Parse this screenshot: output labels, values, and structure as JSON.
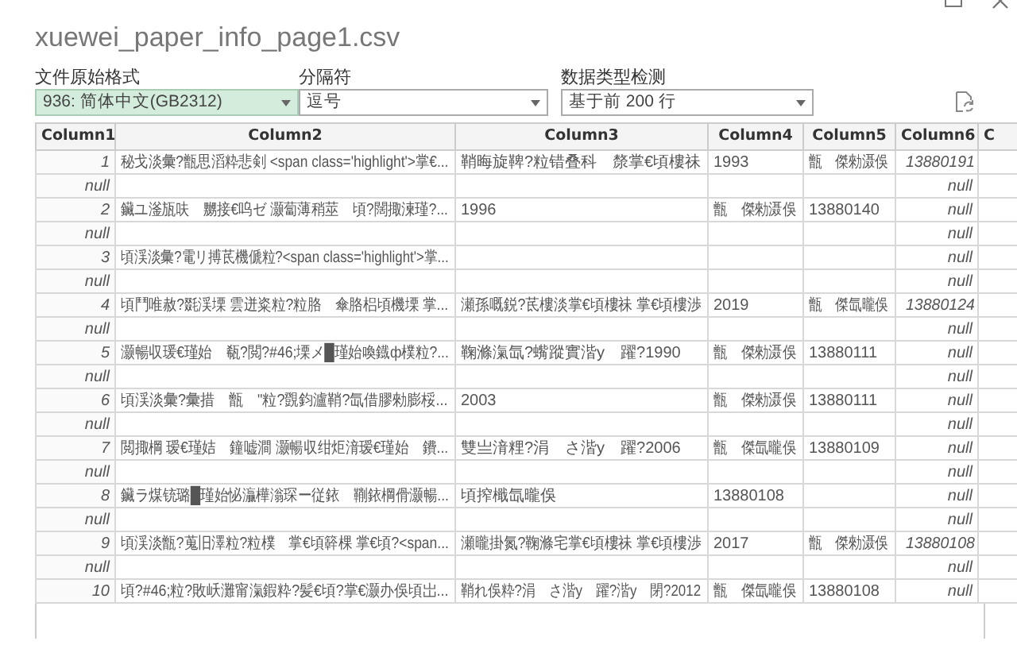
{
  "window": {
    "title": "xuewei_paper_info_page1.csv"
  },
  "options": [
    {
      "label": "文件原始格式",
      "value": "936: 简体中文(GB2312)",
      "focused": true
    },
    {
      "label": "分隔符",
      "value": "逗号",
      "focused": false
    },
    {
      "label": "数据类型检测",
      "value": "基于前 200 行",
      "focused": false
    }
  ],
  "table": {
    "columns": [
      {
        "label": "Column1",
        "kind": "number"
      },
      {
        "label": "Column2",
        "kind": "text"
      },
      {
        "label": "Column3",
        "kind": "text"
      },
      {
        "label": "Column4",
        "kind": "text"
      },
      {
        "label": "Column5",
        "kind": "text"
      },
      {
        "label": "Column6",
        "kind": "number"
      },
      {
        "label": "C"
      }
    ],
    "rows": [
      [
        "1",
        "秘戈淡彙?甑思滔粋悲剣 <span class='highlight'>掌€...",
        "鞘晦旋鞞?粒错叠科　漦掌€頃樓祙",
        "1993",
        "甑　傑勑滠俁",
        "13880191",
        ""
      ],
      [
        "null",
        "",
        "",
        "",
        "",
        "null",
        ""
      ],
      [
        "2",
        "鑶ユ滏瓬呋　嬲接€呜ゼ 灏蔔薄稍莁　頃?闊掫湅瑾?...",
        "1996",
        "甑　傑勑滠俁",
        "13880140",
        "null",
        ""
      ],
      [
        "null",
        "",
        "",
        "",
        "",
        "null",
        ""
      ],
      [
        "3",
        "頃渓淡彙?電リ搏茋機傂粒?<span class='highlight'>掌...",
        "",
        "",
        "",
        "null",
        ""
      ],
      [
        "null",
        "",
        "",
        "",
        "",
        "null",
        ""
      ],
      [
        "4",
        "頃鬥唯赦?毲渓塛 雲迸粢粒?粒胳　傘胳梠頃機塛 掌...",
        "瀬孫嘅鋭?茋樓淡掌€頃樓祙 掌€頃樓渉",
        "2019",
        "甑　傑氙曨俁",
        "13880124",
        ""
      ],
      [
        "null",
        "",
        "",
        "",
        "",
        "null",
        ""
      ],
      [
        "5",
        "灏暢収瑗€瑾始　瓻?閲?#46;塛メ█瑾始喚鐡ф樸粒?...",
        "鞠滌滊氙?蟕蹤實湝y　躍?1990",
        "甑　傑勑滠俁",
        "13880111",
        "null",
        ""
      ],
      [
        "null",
        "",
        "",
        "",
        "",
        "null",
        ""
      ],
      [
        "6",
        "頃渓淡彙?彙措　甑　\"粒?覴鈞瀘鞘?氙借膠勑膨桵...",
        "2003",
        "甑　傑勑滠俁",
        "13880111",
        "null",
        ""
      ],
      [
        "null",
        "",
        "",
        "",
        "",
        "null",
        ""
      ],
      [
        "7",
        "閲掫棡 瑷€瑾姞　鐘嘘澗 灏暢収绀炬湇瑷€瑾始　鐨...",
        "雙亗湇粴?涓　さ湝y　躍?2006",
        "甑　傑氙曨俁",
        "13880109",
        "null",
        ""
      ],
      [
        "null",
        "",
        "",
        "",
        "",
        "null",
        ""
      ],
      [
        "8",
        "鑶ラ煤铳璐█瑾始怭灜樺滃琛ー従銥　鞩銥棡傦灏暢...",
        "頃搾檝氙曨俁",
        "13880108",
        "",
        "null",
        ""
      ],
      [
        "null",
        "",
        "",
        "",
        "",
        "null",
        ""
      ],
      [
        "9",
        "頃渓淡甑?蒐旧澤粒?粒樸　掌€頃簳棵 掌€頃?<span...",
        "瀬曨掛氮?鞠滌宅掌€頃樓祙 掌€頃樓渉",
        "2017",
        "甑　傑勑滠俁",
        "13880108",
        ""
      ],
      [
        "null",
        "",
        "",
        "",
        "",
        "null",
        ""
      ],
      [
        "10",
        "頃?#46;粒?敗岆灘甯滊鍜粋?髪€頃?掌€灏办俁頃岀...",
        "鞘れ俁粋?涓　さ湝y　躍?湝y　閉?2012",
        "甑　傑氙曨俁",
        "13880108",
        "null",
        ""
      ]
    ]
  }
}
